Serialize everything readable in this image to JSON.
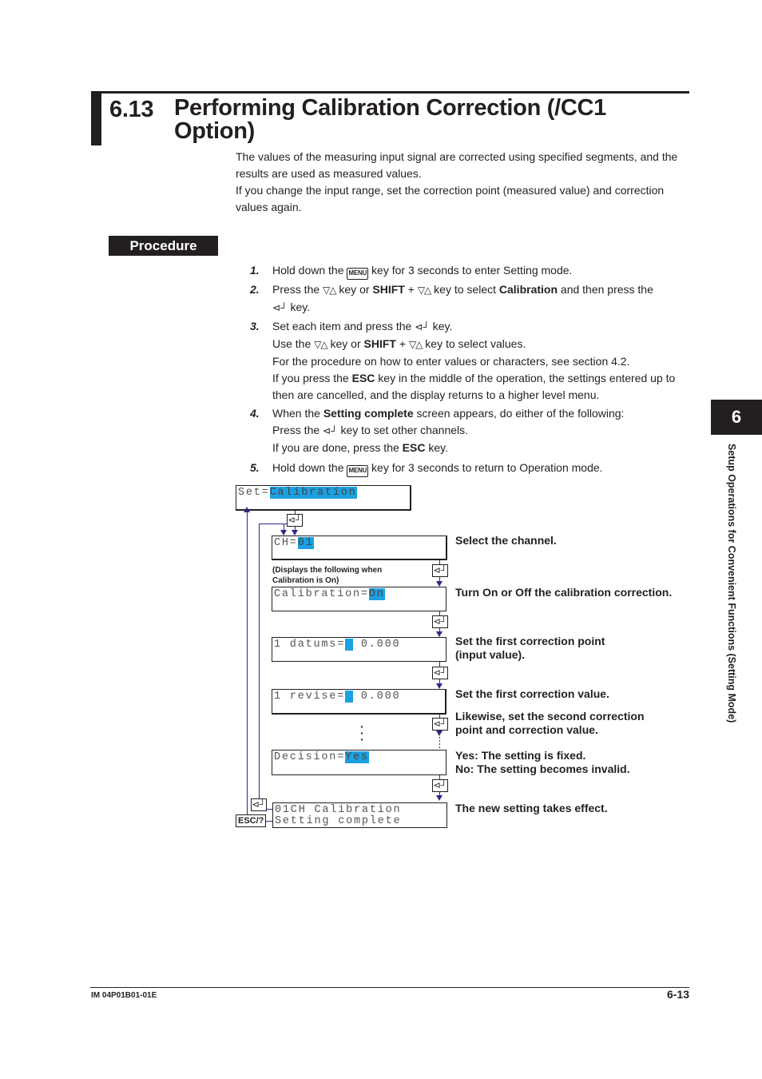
{
  "heading": {
    "number": "6.13",
    "title": "Performing Calibration Correction (/CC1 Option)"
  },
  "intro": [
    "The values of the measuring input signal are corrected using specified segments, and the results are used as measured values.",
    "If you change the input range, set the correction point (measured value) and correction values again."
  ],
  "procedure_label": "Procedure",
  "keys": {
    "menu": "MENU",
    "updown": "▽△",
    "enter": "⊲┘",
    "shift": "SHIFT",
    "esc": "ESC",
    "esc_help": "ESC/?"
  },
  "steps": [
    {
      "num": "1.",
      "parts": {
        "a": "Hold down the ",
        "b": " key for 3 seconds to enter Setting mode."
      }
    },
    {
      "num": "2.",
      "parts": {
        "a": "Press the ",
        "b": " key or ",
        "c": "SHIFT",
        "d": " + ",
        "e": " key to select ",
        "f": "Calibration",
        "g": " and then press the",
        "h": " key."
      }
    },
    {
      "num": "3.",
      "parts": {
        "a": "Set each item and press the ",
        "b": " key.",
        "c": "Use the ",
        "d": " key or ",
        "e": "SHIFT",
        "f": " + ",
        "g": " key to select values.",
        "h": "For the procedure on how to enter values or characters, see section 4.2.",
        "i": "If you press the ",
        "j": "ESC",
        "k": " key in the middle of the operation, the settings entered up to then are cancelled, and the display returns to a higher level menu."
      }
    },
    {
      "num": "4.",
      "parts": {
        "a": "When the ",
        "b": "Setting complete",
        "c": " screen appears, do either of the following:",
        "d": "Press the ",
        "e": " key to set other channels.",
        "f": "If you are done, press the ",
        "g": "ESC",
        "h": " key."
      }
    },
    {
      "num": "5.",
      "parts": {
        "a": "Hold down the ",
        "b": " key for 3 seconds to return to Operation mode."
      }
    }
  ],
  "diagram": {
    "screens": {
      "set": {
        "label": "Set=",
        "value": "Calibration"
      },
      "ch": {
        "label": "CH=",
        "value": "01"
      },
      "calib": {
        "label": "Calibration=",
        "value": "On"
      },
      "datums": {
        "label": "1 datums=",
        "value": " ",
        "num": " 0.000"
      },
      "revise": {
        "label": "1 revise=",
        "value": " ",
        "num": " 0.000"
      },
      "decision": {
        "label": "Decision=",
        "value": "Yes"
      },
      "complete": {
        "line1": "01CH Calibration",
        "line2": "Setting complete"
      }
    },
    "notes": {
      "displays_when": "(Displays the following when",
      "displays_when2": " Calibration is On)",
      "select_channel": "Select the channel.",
      "turn_on_off": "Turn On or Off the calibration correction.",
      "first_point": "Set the first correction point",
      "first_point2": "(input value).",
      "first_value": "Set the first correction value.",
      "likewise": "Likewise, set the second correction",
      "likewise2": "point and correction value.",
      "yes": "Yes: The setting is fixed.",
      "no": "No: The setting becomes invalid.",
      "takes_effect": "The new setting takes effect."
    },
    "highlight_color": "#1ba1e2",
    "flow_color": "#2b2b86"
  },
  "side_tab": {
    "number": "6",
    "label": "Setup Operations for Convenient Functions (Setting Mode)"
  },
  "footer": {
    "doc_id": "IM 04P01B01-01E",
    "page": "6-13"
  }
}
